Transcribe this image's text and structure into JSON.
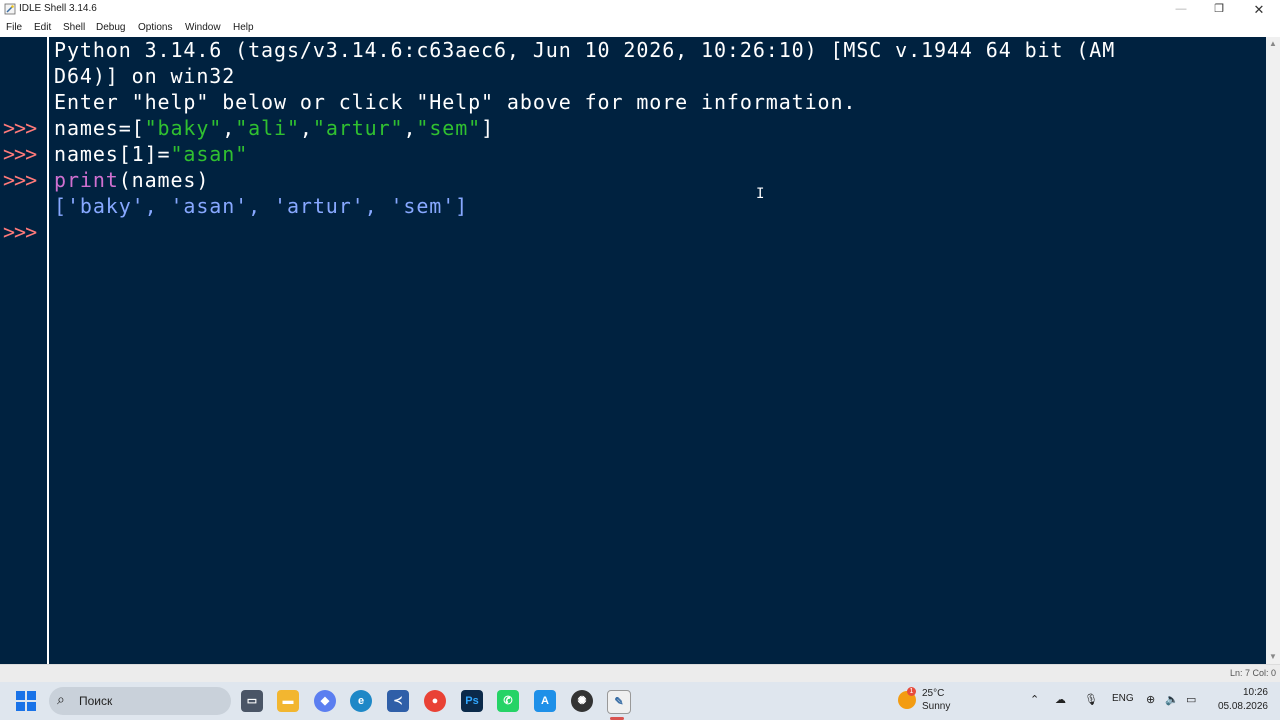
{
  "window": {
    "title": "IDLE Shell 3.14.6",
    "controls": {
      "minimize": "—",
      "maximize": "❐",
      "close": "✕"
    }
  },
  "menu": [
    "File",
    "Edit",
    "Shell",
    "Debug",
    "Options",
    "Window",
    "Help"
  ],
  "shell": {
    "prompt": ">>>",
    "banner_line1": "Python 3.14.6 (tags/v3.14.6:c63aec6, Jun 10 2026, 10:26:10) [MSC v.1944 64 bit (AM",
    "banner_line2": "D64)] on win32",
    "banner_line3": "Enter \"help\" below or click \"Help\" above for more information.",
    "cmd1": {
      "a": "names=[",
      "s1": "\"baky\"",
      "c1": ",",
      "s2": "\"ali\"",
      "c2": ",",
      "s3": "\"artur\"",
      "c3": ",",
      "s4": "\"sem\"",
      "b": "]"
    },
    "cmd2": {
      "a": "names[1]=",
      "s1": "\"asan\""
    },
    "cmd3": {
      "kw": "print",
      "rest": "(names)"
    },
    "output": "['baky', 'asan', 'artur', 'sem']",
    "colors": {
      "background": "#002240",
      "string": "#30c030",
      "builtin": "#d070d0",
      "prompt": "#ff7a7a",
      "output": "#87a8ff"
    }
  },
  "status": {
    "position": "Ln: 7   Col: 0"
  },
  "taskbar": {
    "search_placeholder": "Поиск",
    "weather": {
      "temp": "25°C",
      "condition": "Sunny",
      "alert": "1"
    },
    "tray": {
      "language": "ENG",
      "time": "10:26",
      "date": "05.08.2026"
    },
    "apps": [
      "task-view",
      "file-explorer",
      "copilot",
      "edge",
      "vscode",
      "chrome",
      "photoshop",
      "whatsapp",
      "azure",
      "chatgpt",
      "idle"
    ]
  }
}
